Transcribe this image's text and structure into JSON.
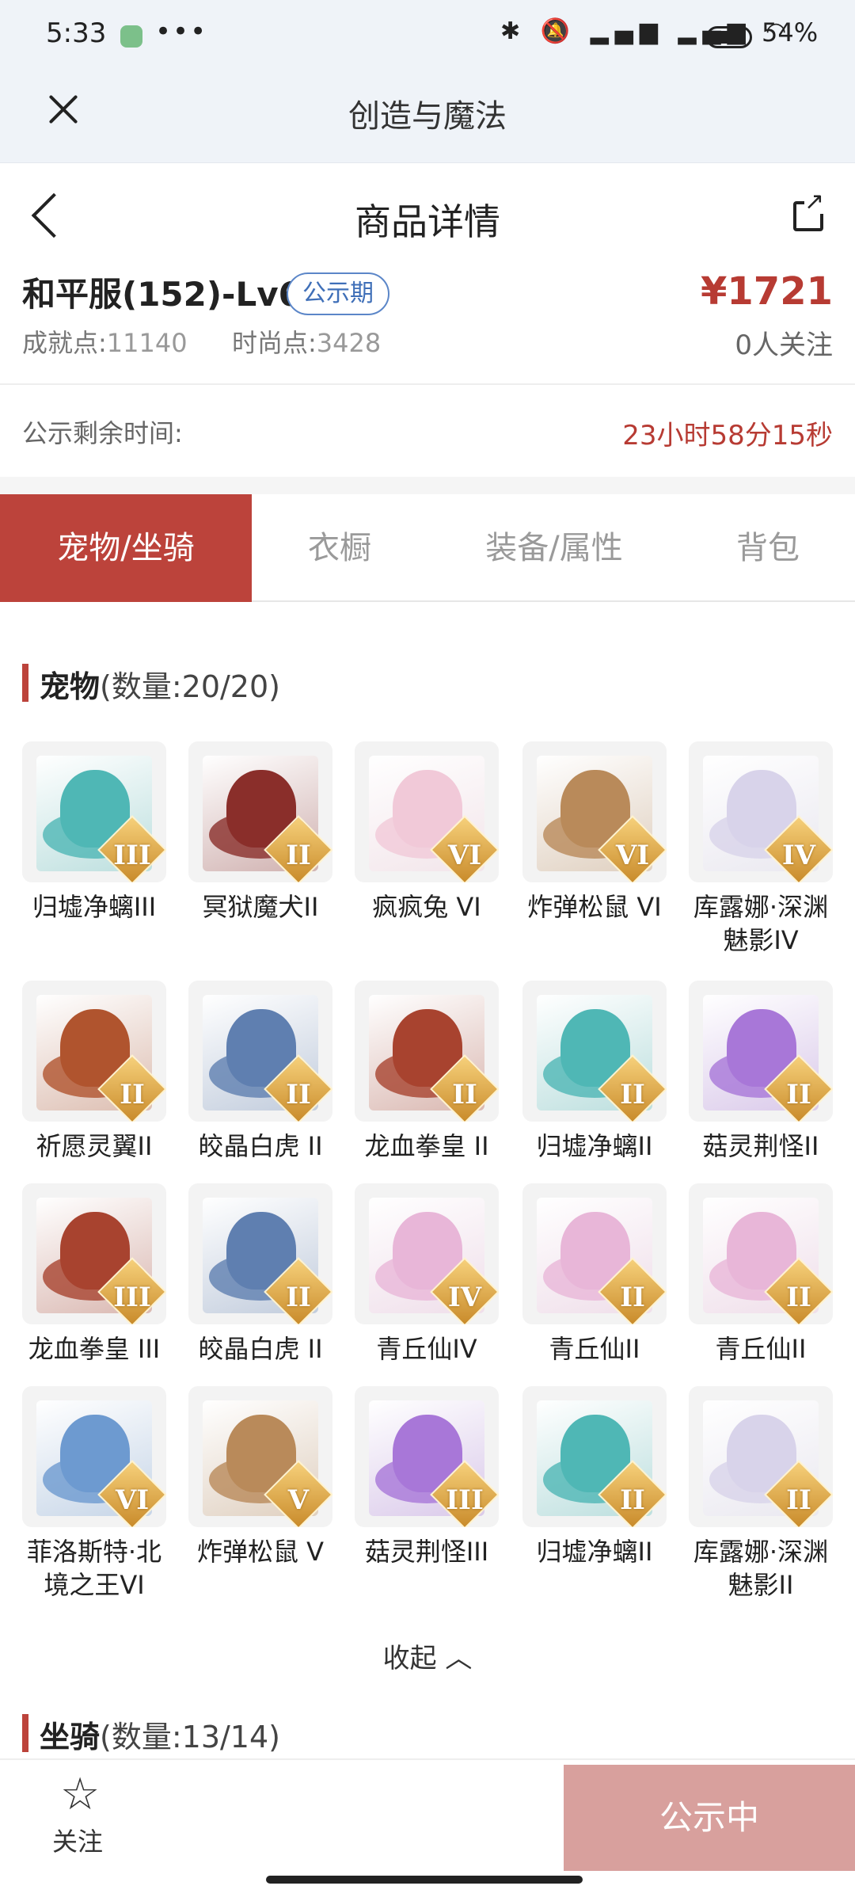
{
  "status_bar": {
    "time": "5:33",
    "battery": "54%",
    "dots": "•••"
  },
  "webview": {
    "title": "创造与魔法"
  },
  "nav": {
    "title": "商品详情"
  },
  "product": {
    "name": "和平服(152)-Lv69",
    "badge": "公示期",
    "price": "¥1721",
    "achievement_label": "成就点:",
    "achievement_value": "11140",
    "fashion_label": "时尚点:",
    "fashion_value": "3428",
    "followers": "0人关注"
  },
  "timer": {
    "label": "公示剩余时间:",
    "value": "23小时58分15秒"
  },
  "tabs": [
    {
      "label": "宠物/坐骑",
      "active": true
    },
    {
      "label": "衣橱",
      "active": false
    },
    {
      "label": "装备/属性",
      "active": false
    },
    {
      "label": "背包",
      "active": false
    }
  ],
  "pets_section": {
    "title": "宠物",
    "count": "(数量:20/20)"
  },
  "pets": [
    {
      "name": "归墟净螭III",
      "rank": "III",
      "color": "#4fb7b5"
    },
    {
      "name": "冥狱魔犬II",
      "rank": "II",
      "color": "#8a2e2a"
    },
    {
      "name": "疯疯兔 VI",
      "rank": "VI",
      "color": "#f1c9d8"
    },
    {
      "name": "炸弹松鼠 VI",
      "rank": "VI",
      "color": "#b98a5a"
    },
    {
      "name": "库露娜·深渊魅影IV",
      "rank": "IV",
      "color": "#d8d3ea"
    },
    {
      "name": "祈愿灵翼II",
      "rank": "II",
      "color": "#b0542e"
    },
    {
      "name": "皎晶白虎 II",
      "rank": "II",
      "color": "#5f7fb0"
    },
    {
      "name": "龙血拳皇 II",
      "rank": "II",
      "color": "#a8432f"
    },
    {
      "name": "归墟净螭II",
      "rank": "II",
      "color": "#4fb7b5"
    },
    {
      "name": "菇灵荆怪II",
      "rank": "II",
      "color": "#a877d8"
    },
    {
      "name": "龙血拳皇 III",
      "rank": "III",
      "color": "#a8432f"
    },
    {
      "name": "皎晶白虎 II",
      "rank": "II",
      "color": "#5f7fb0"
    },
    {
      "name": "青丘仙IV",
      "rank": "IV",
      "color": "#e8b6d8"
    },
    {
      "name": "青丘仙II",
      "rank": "II",
      "color": "#e8b6d8"
    },
    {
      "name": "青丘仙II",
      "rank": "II",
      "color": "#e8b6d8"
    },
    {
      "name": "菲洛斯特·北境之王VI",
      "rank": "VI",
      "color": "#6d9ad0"
    },
    {
      "name": "炸弹松鼠 V",
      "rank": "V",
      "color": "#b98a5a"
    },
    {
      "name": "菇灵荆怪III",
      "rank": "III",
      "color": "#a877d8"
    },
    {
      "name": "归墟净螭II",
      "rank": "II",
      "color": "#4fb7b5"
    },
    {
      "name": "库露娜·深渊魅影II",
      "rank": "II",
      "color": "#d8d3ea"
    }
  ],
  "collapse_label": "收起 ︿",
  "mounts_section": {
    "title": "坐骑",
    "count": "(数量:13/14)"
  },
  "bottom": {
    "follow_label": "关注",
    "status_button": "公示中"
  },
  "colors": {
    "accent": "#bc433b",
    "price": "#b73b33",
    "badge": "#3f6fb8",
    "cta": "#d8a09d"
  }
}
